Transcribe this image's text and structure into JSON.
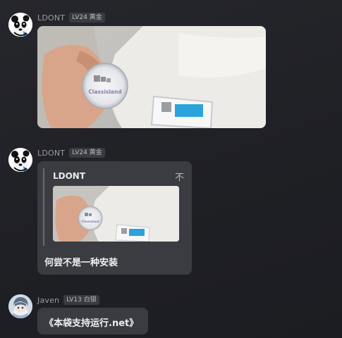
{
  "messages": [
    {
      "sender": "LDONT",
      "badge": "LV24 黄金",
      "avatar_icon": "panda-avatar-icon",
      "content_type": "image",
      "image_caption": "Classisland"
    },
    {
      "sender": "LDONT",
      "badge": "LV24 黄金",
      "avatar_icon": "panda-avatar-icon",
      "content_type": "reply",
      "reply": {
        "author": "LDONT",
        "mark": "不",
        "image_caption": "Classisland"
      },
      "text": "何尝不是一种安装"
    },
    {
      "sender": "Javen",
      "badge": "LV13 白银",
      "avatar_icon": "anime-avatar-icon",
      "content_type": "text",
      "text": "《本袋支持运行.net》"
    }
  ],
  "colors": {
    "background": "#222328",
    "bubble": "#3b3c42",
    "badge_bg": "#3a3b41",
    "name_text": "#9a9ba1",
    "accent_blue": "#2a9fd8"
  }
}
